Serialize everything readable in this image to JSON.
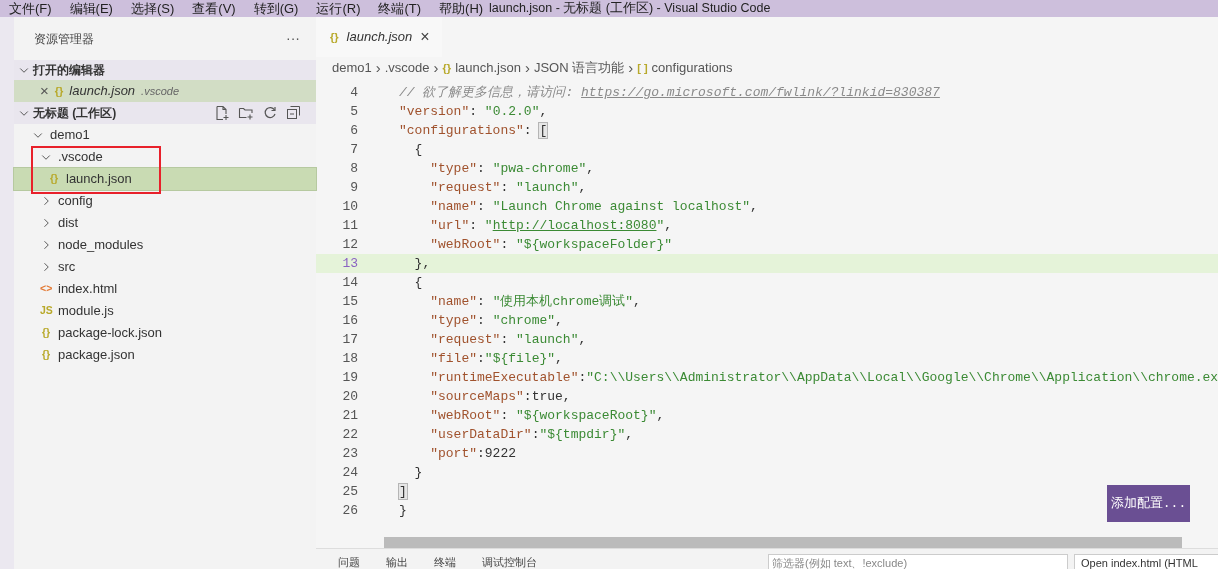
{
  "menu_bar": {
    "items": [
      "文件(F)",
      "编辑(E)",
      "选择(S)",
      "查看(V)",
      "转到(G)",
      "运行(R)",
      "终端(T)",
      "帮助(H)"
    ],
    "title": "launch.json - 无标题 (工作区) - Visual Studio Code"
  },
  "sidebar": {
    "title": "资源管理器",
    "more": "···",
    "open_editors": {
      "title": "打开的编辑器",
      "expanded": true,
      "items": [
        {
          "close": "×",
          "icon": "{}",
          "name": "launch.json",
          "path": ".vscode",
          "selected": true
        }
      ]
    },
    "workspace": {
      "title": "无标题 (工作区)",
      "expanded": true,
      "tree": [
        {
          "kind": "folder",
          "name": "demo1",
          "expanded": true,
          "selected": false,
          "outlined": false,
          "children": [
            {
              "kind": "folder",
              "name": ".vscode",
              "expanded": true,
              "selected": false,
              "outlined": true,
              "children": [
                {
                  "kind": "json",
                  "icon": "{}",
                  "name": "launch.json",
                  "selected": true,
                  "outlined": true
                }
              ]
            },
            {
              "kind": "folder",
              "name": "config",
              "expanded": false,
              "selected": false,
              "outlined": false
            },
            {
              "kind": "folder",
              "name": "dist",
              "expanded": false,
              "selected": false,
              "outlined": false
            },
            {
              "kind": "folder",
              "name": "node_modules",
              "expanded": false,
              "selected": false,
              "outlined": false
            },
            {
              "kind": "folder",
              "name": "src",
              "expanded": false,
              "selected": false,
              "outlined": false
            },
            {
              "kind": "html",
              "icon": "<>",
              "name": "index.html",
              "selected": false,
              "outlined": false
            },
            {
              "kind": "js",
              "icon": "JS",
              "name": "module.js",
              "selected": false,
              "outlined": false
            },
            {
              "kind": "json",
              "icon": "{}",
              "name": "package-lock.json",
              "selected": false,
              "outlined": false
            },
            {
              "kind": "json",
              "icon": "{}",
              "name": "package.json",
              "selected": false,
              "outlined": false
            }
          ]
        }
      ]
    }
  },
  "editor": {
    "tabs": [
      {
        "icon": "{}",
        "label": "launch.json",
        "close": "×",
        "selected": true
      }
    ],
    "breadcrumb": [
      {
        "text": "demo1"
      },
      {
        "text": ".vscode"
      },
      {
        "icon": "{}",
        "text": "launch.json"
      },
      {
        "text": "JSON 语言功能"
      },
      {
        "icon": "[ ]",
        "text": "configurations"
      }
    ],
    "breadcrumb_separator": "›",
    "lines": [
      {
        "number": "4",
        "current": false,
        "tokens": [
          {
            "kind": "comment",
            "text": "// 欲了解更多信息，请访问: "
          },
          {
            "kind": "commentlink",
            "text": "https://go.microsoft.com/fwlink/?linkid=830387"
          }
        ]
      },
      {
        "number": "5",
        "current": false,
        "tokens": [
          {
            "kind": "key",
            "text": "\"version\""
          },
          {
            "kind": "punct",
            "text": ": "
          },
          {
            "kind": "string",
            "text": "\"0.2.0\""
          },
          {
            "kind": "punct",
            "text": ","
          }
        ]
      },
      {
        "number": "6",
        "current": false,
        "tokens": [
          {
            "kind": "key",
            "text": "\"configurations\""
          },
          {
            "kind": "punct",
            "text": ": "
          },
          {
            "kind": "bracket",
            "text": "["
          }
        ]
      },
      {
        "number": "7",
        "current": false,
        "tokens": [
          {
            "kind": "punct",
            "text": "  {"
          }
        ]
      },
      {
        "number": "8",
        "current": false,
        "tokens": [
          {
            "kind": "key",
            "text": "    \"type\""
          },
          {
            "kind": "punct",
            "text": ": "
          },
          {
            "kind": "string",
            "text": "\"pwa-chrome\""
          },
          {
            "kind": "punct",
            "text": ","
          }
        ]
      },
      {
        "number": "9",
        "current": false,
        "tokens": [
          {
            "kind": "key",
            "text": "    \"request\""
          },
          {
            "kind": "punct",
            "text": ": "
          },
          {
            "kind": "string",
            "text": "\"launch\""
          },
          {
            "kind": "punct",
            "text": ","
          }
        ]
      },
      {
        "number": "10",
        "current": false,
        "tokens": [
          {
            "kind": "key",
            "text": "    \"name\""
          },
          {
            "kind": "punct",
            "text": ": "
          },
          {
            "kind": "string",
            "text": "\"Launch Chrome against localhost\""
          },
          {
            "kind": "punct",
            "text": ","
          }
        ]
      },
      {
        "number": "11",
        "current": false,
        "tokens": [
          {
            "kind": "key",
            "text": "    \"url\""
          },
          {
            "kind": "punct",
            "text": ": "
          },
          {
            "kind": "string",
            "text": "\""
          },
          {
            "kind": "link",
            "text": "http://localhost:8080"
          },
          {
            "kind": "string",
            "text": "\""
          },
          {
            "kind": "punct",
            "text": ","
          }
        ]
      },
      {
        "number": "12",
        "current": false,
        "tokens": [
          {
            "kind": "key",
            "text": "    \"webRoot\""
          },
          {
            "kind": "punct",
            "text": ": "
          },
          {
            "kind": "string",
            "text": "\"${workspaceFolder}\""
          }
        ]
      },
      {
        "number": "13",
        "current": true,
        "tokens": [
          {
            "kind": "punct",
            "text": "  },"
          }
        ]
      },
      {
        "number": "14",
        "current": false,
        "tokens": [
          {
            "kind": "punct",
            "text": "  {"
          }
        ]
      },
      {
        "number": "15",
        "current": false,
        "tokens": [
          {
            "kind": "key",
            "text": "    \"name\""
          },
          {
            "kind": "punct",
            "text": ": "
          },
          {
            "kind": "string",
            "text": "\"使用本机chrome调试\""
          },
          {
            "kind": "punct",
            "text": ","
          }
        ]
      },
      {
        "number": "16",
        "current": false,
        "tokens": [
          {
            "kind": "key",
            "text": "    \"type\""
          },
          {
            "kind": "punct",
            "text": ": "
          },
          {
            "kind": "string",
            "text": "\"chrome\""
          },
          {
            "kind": "punct",
            "text": ","
          }
        ]
      },
      {
        "number": "17",
        "current": false,
        "tokens": [
          {
            "kind": "key",
            "text": "    \"request\""
          },
          {
            "kind": "punct",
            "text": ": "
          },
          {
            "kind": "string",
            "text": "\"launch\""
          },
          {
            "kind": "punct",
            "text": ","
          }
        ]
      },
      {
        "number": "18",
        "current": false,
        "tokens": [
          {
            "kind": "key",
            "text": "    \"file\""
          },
          {
            "kind": "punct",
            "text": ":"
          },
          {
            "kind": "string",
            "text": "\"${file}\""
          },
          {
            "kind": "punct",
            "text": ","
          }
        ]
      },
      {
        "number": "19",
        "current": false,
        "tokens": [
          {
            "kind": "key",
            "text": "    \"runtimeExecutable\""
          },
          {
            "kind": "punct",
            "text": ":"
          },
          {
            "kind": "string",
            "text": "\"C:\\\\Users\\\\Administrator\\\\AppData\\\\Local\\\\Google\\\\Chrome\\\\Application\\\\chrome.ex"
          }
        ]
      },
      {
        "number": "20",
        "current": false,
        "tokens": [
          {
            "kind": "key",
            "text": "    \"sourceMaps\""
          },
          {
            "kind": "punct",
            "text": ":true,"
          }
        ]
      },
      {
        "number": "21",
        "current": false,
        "tokens": [
          {
            "kind": "key",
            "text": "    \"webRoot\""
          },
          {
            "kind": "punct",
            "text": ": "
          },
          {
            "kind": "string",
            "text": "\"${workspaceRoot}\""
          },
          {
            "kind": "punct",
            "text": ","
          }
        ]
      },
      {
        "number": "22",
        "current": false,
        "tokens": [
          {
            "kind": "key",
            "text": "    \"userDataDir\""
          },
          {
            "kind": "punct",
            "text": ":"
          },
          {
            "kind": "string",
            "text": "\"${tmpdir}\""
          },
          {
            "kind": "punct",
            "text": ","
          }
        ]
      },
      {
        "number": "23",
        "current": false,
        "tokens": [
          {
            "kind": "key",
            "text": "    \"port\""
          },
          {
            "kind": "punct",
            "text": ":9222"
          }
        ]
      },
      {
        "number": "24",
        "current": false,
        "tokens": [
          {
            "kind": "punct",
            "text": "  }"
          }
        ]
      },
      {
        "number": "25",
        "current": false,
        "tokens": [
          {
            "kind": "bracket",
            "text": "]"
          }
        ]
      },
      {
        "number": "26",
        "current": false,
        "tokens": [
          {
            "kind": "punct",
            "text": "}"
          }
        ]
      }
    ],
    "add_config_button": "添加配置..."
  },
  "panel": {
    "tabs": [
      {
        "label": "问题",
        "selected": false
      },
      {
        "label": "输出",
        "selected": false
      },
      {
        "label": "终端",
        "selected": false
      },
      {
        "label": "调试控制台",
        "selected": false
      }
    ],
    "filter": {
      "placeholder": "筛选器(例如 text、!exclude)"
    },
    "dropdown": "Open index.html (HTML"
  }
}
